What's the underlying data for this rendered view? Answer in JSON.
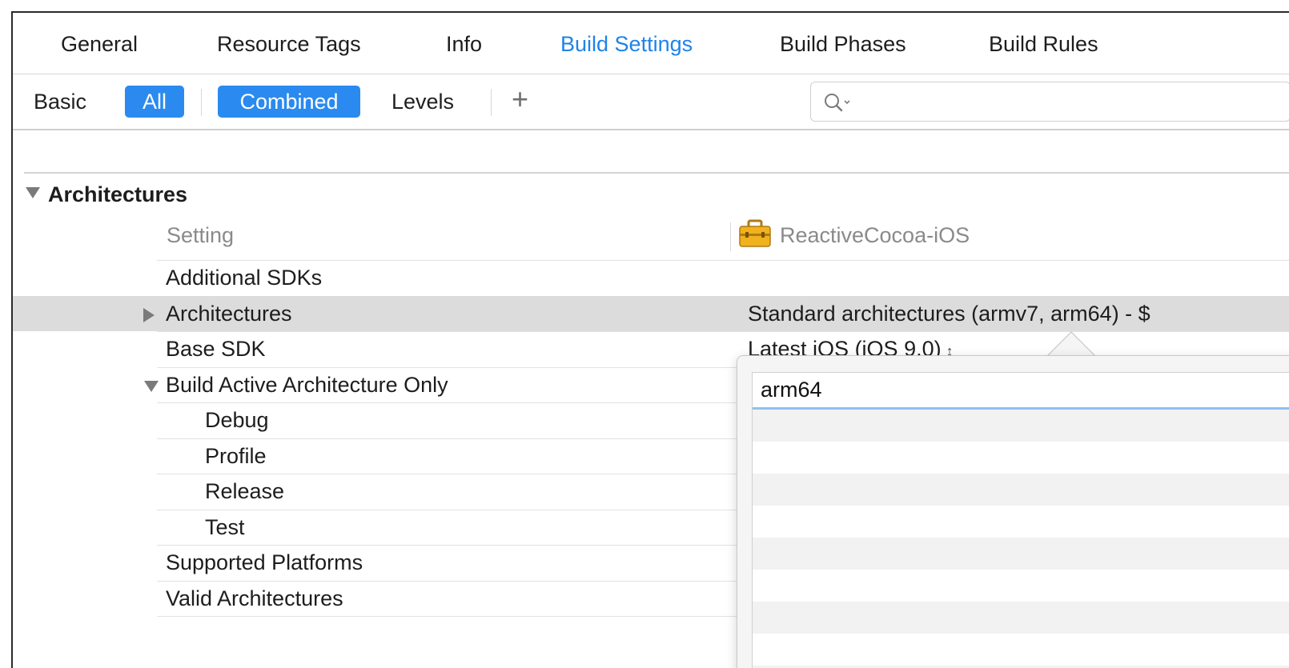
{
  "tabs": [
    {
      "label": "General",
      "active": false
    },
    {
      "label": "Resource Tags",
      "active": false
    },
    {
      "label": "Info",
      "active": false
    },
    {
      "label": "Build Settings",
      "active": true
    },
    {
      "label": "Build Phases",
      "active": false
    },
    {
      "label": "Build Rules",
      "active": false
    }
  ],
  "filter_bar": {
    "basic": "Basic",
    "all": "All",
    "combined": "Combined",
    "levels": "Levels",
    "add": "+",
    "search_value": ""
  },
  "section": {
    "title": "Architectures",
    "column_setting": "Setting",
    "column_target": "ReactiveCocoa-iOS",
    "target_icon": "toolbox-icon"
  },
  "rows": [
    {
      "label": "Additional SDKs",
      "value": ""
    },
    {
      "label": "Architectures",
      "value": "Standard architectures (armv7, arm64)  -  $"
    },
    {
      "label": "Base SDK",
      "value": "Latest iOS (iOS 9.0)"
    },
    {
      "label": "Build Active Architecture Only",
      "value": ""
    },
    {
      "label": "Debug",
      "value": ""
    },
    {
      "label": "Profile",
      "value": ""
    },
    {
      "label": "Release",
      "value": ""
    },
    {
      "label": "Test",
      "value": ""
    },
    {
      "label": "Supported Platforms",
      "value": ""
    },
    {
      "label": "Valid Architectures",
      "value": ""
    }
  ],
  "popover": {
    "items": [
      "arm64"
    ]
  },
  "colors": {
    "accent": "#2a8aef",
    "active_tab": "#1f83e8",
    "selected_row": "#dcdcdc"
  }
}
